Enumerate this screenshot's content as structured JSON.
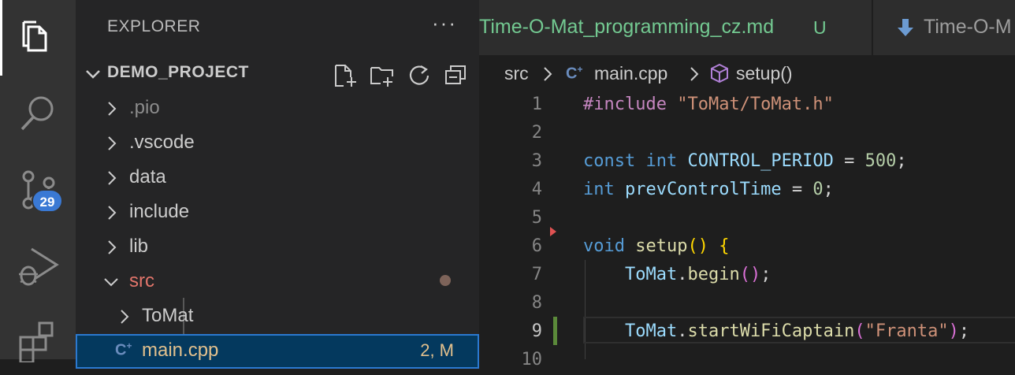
{
  "activity_bar": {
    "items": [
      {
        "name": "explorer",
        "icon": "files-icon"
      },
      {
        "name": "search",
        "icon": "search-icon"
      },
      {
        "name": "source-control",
        "icon": "source-control-icon",
        "badge": "29"
      },
      {
        "name": "run-debug",
        "icon": "run-debug-icon"
      },
      {
        "name": "extensions",
        "icon": "extensions-icon"
      }
    ],
    "source_control_badge": "29"
  },
  "sidebar": {
    "title": "EXPLORER",
    "more_actions": "···",
    "project": {
      "name": "DEMO_PROJECT",
      "actions": [
        "new-file-icon",
        "new-folder-icon",
        "refresh-icon",
        "collapse-all-icon"
      ]
    },
    "tree": [
      {
        "label": ".pio",
        "type": "folder",
        "expanded": false,
        "color": "#8c8c8c"
      },
      {
        "label": ".vscode",
        "type": "folder",
        "expanded": false,
        "color": "#cccccc"
      },
      {
        "label": "data",
        "type": "folder",
        "expanded": false,
        "color": "#cccccc"
      },
      {
        "label": "include",
        "type": "folder",
        "expanded": false,
        "color": "#cccccc"
      },
      {
        "label": "lib",
        "type": "folder",
        "expanded": false,
        "color": "#cccccc"
      },
      {
        "label": "src",
        "type": "folder",
        "expanded": true,
        "color": "#e2756b"
      },
      {
        "label": "ToMat",
        "type": "folder",
        "expanded": false,
        "color": "#cccccc"
      },
      {
        "label": "main.cpp",
        "type": "file",
        "icon": "cpp-file-icon",
        "status": "2, M",
        "selected": true,
        "color": "#e2c08d"
      }
    ]
  },
  "tabs": [
    {
      "label": "Time-O-Mat_programming_cz.md",
      "badge": "U",
      "color": "#73c991"
    },
    {
      "label": "Time-O-M",
      "icon": "markdown-down-arrow-icon",
      "color": "#9d9d9d"
    }
  ],
  "breadcrumbs": [
    "src",
    "main.cpp",
    "setup()"
  ],
  "editor": {
    "lines": [
      {
        "n": "1",
        "tokens": [
          {
            "t": "#include ",
            "c": "dir"
          },
          {
            "t": "\"ToMat/ToMat.h\"",
            "c": "str"
          }
        ]
      },
      {
        "n": "2",
        "tokens": []
      },
      {
        "n": "3",
        "tokens": [
          {
            "t": "const ",
            "c": "kw"
          },
          {
            "t": "int ",
            "c": "kw"
          },
          {
            "t": "CONTROL_PERIOD",
            "c": "id"
          },
          {
            "t": " = ",
            "c": "op"
          },
          {
            "t": "500",
            "c": "num"
          },
          {
            "t": ";",
            "c": "op"
          }
        ]
      },
      {
        "n": "4",
        "tokens": [
          {
            "t": "int ",
            "c": "kw"
          },
          {
            "t": "prevControlTime",
            "c": "id"
          },
          {
            "t": " = ",
            "c": "op"
          },
          {
            "t": "0",
            "c": "num"
          },
          {
            "t": ";",
            "c": "op"
          }
        ]
      },
      {
        "n": "5",
        "tokens": []
      },
      {
        "n": "6",
        "tokens": [
          {
            "t": "void ",
            "c": "kw"
          },
          {
            "t": "setup",
            "c": "fn"
          },
          {
            "t": "() {",
            "c": "br1"
          }
        ]
      },
      {
        "n": "7",
        "tokens": [
          {
            "t": "    ",
            "c": "op"
          },
          {
            "t": "ToMat",
            "c": "cls"
          },
          {
            "t": ".",
            "c": "op"
          },
          {
            "t": "begin",
            "c": "fn"
          },
          {
            "t": "()",
            "c": "br2"
          },
          {
            "t": ";",
            "c": "op"
          }
        ]
      },
      {
        "n": "8",
        "tokens": []
      },
      {
        "n": "9",
        "tokens": [
          {
            "t": "    ",
            "c": "op"
          },
          {
            "t": "ToMat",
            "c": "cls"
          },
          {
            "t": ".",
            "c": "op"
          },
          {
            "t": "startWiFiCaptain",
            "c": "fn"
          },
          {
            "t": "(",
            "c": "br2"
          },
          {
            "t": "\"Franta\"",
            "c": "str"
          },
          {
            "t": ")",
            "c": "br2"
          },
          {
            "t": ";",
            "c": "op"
          }
        ]
      },
      {
        "n": "10",
        "tokens": []
      }
    ],
    "active_line": "9"
  }
}
